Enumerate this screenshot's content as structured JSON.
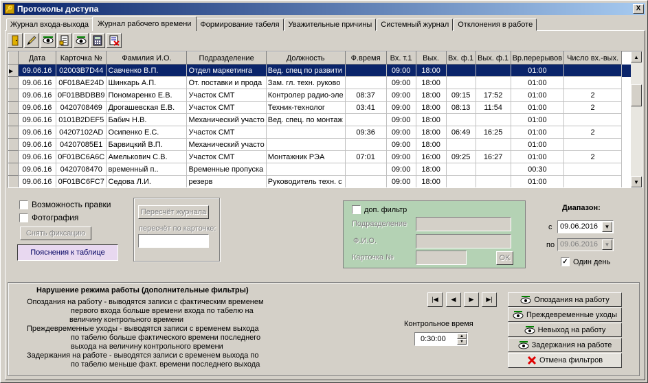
{
  "window": {
    "title": "Протоколы доступа",
    "close_glyph": "X"
  },
  "tabs": [
    {
      "label": "Журнал входа-выхода"
    },
    {
      "label": "Журнал рабочего времени",
      "active": true
    },
    {
      "label": "Формирование табеля"
    },
    {
      "label": "Уважительные причины"
    },
    {
      "label": "Системный журнал"
    },
    {
      "label": "Отклонения в работе"
    }
  ],
  "toolbar": {
    "icons": [
      "door-icon",
      "pen-icon",
      "eye-icon",
      "document-icon",
      "eye-icon",
      "calculator-icon",
      "delete-doc-icon"
    ]
  },
  "grid": {
    "columns": [
      "Дата",
      "Карточка №",
      "Фамилия И.О.",
      "Подразделение",
      "Должность",
      "Ф.время",
      "Вх. т.1",
      "Вых.",
      "Вх. ф.1",
      "Вых. ф.1",
      "Вр.перерывов",
      "Число вх.-вых."
    ],
    "rows": [
      [
        "09.06.16",
        "02003B7D44",
        "Савченко В.П.",
        "Отдел маркетинга",
        "Вед. спец по развити",
        "",
        "09:00",
        "18:00",
        "",
        "",
        "01:00",
        ""
      ],
      [
        "09.06.16",
        "0F018AE24D",
        "Шинкарь А.П.",
        "От. поставки и прода",
        "Зам. гл. техн. руково",
        "",
        "09:00",
        "18:00",
        "",
        "",
        "01:00",
        ""
      ],
      [
        "09.06.16",
        "0F01BBDBB9",
        "Пономаренко Е.В.",
        "Участок СМТ",
        "Контролер радио-эле",
        "08:37",
        "09:00",
        "18:00",
        "09:15",
        "17:52",
        "01:00",
        "2"
      ],
      [
        "09.06.16",
        "0420708469",
        "Дрогашевская Е.В.",
        "Участок СМТ",
        "Техник-технолог",
        "03:41",
        "09:00",
        "18:00",
        "08:13",
        "11:54",
        "01:00",
        "2"
      ],
      [
        "09.06.16",
        "0101B2DEF5",
        "Бабич Н.В.",
        "Механический участо",
        "Вед. спец. по монтаж",
        "",
        "09:00",
        "18:00",
        "",
        "",
        "01:00",
        ""
      ],
      [
        "09.06.16",
        "04207102AD",
        "Осипенко Е.С.",
        "Участок СМТ",
        "",
        "09:36",
        "09:00",
        "18:00",
        "06:49",
        "16:25",
        "01:00",
        "2"
      ],
      [
        "09.06.16",
        "04207085E1",
        "Барвицкий В.П.",
        "Механический участо",
        "",
        "",
        "09:00",
        "18:00",
        "",
        "",
        "01:00",
        ""
      ],
      [
        "09.06.16",
        "0F01BC6A6C",
        "Амелькович С.В.",
        "Участок СМТ",
        "Монтажник РЭА",
        "07:01",
        "09:00",
        "16:00",
        "09:25",
        "16:27",
        "01:00",
        "2"
      ],
      [
        "09.06.16",
        "0420708470",
        "временный п..",
        "Временные пропуска",
        "",
        "",
        "09:00",
        "18:00",
        "",
        "",
        "00:30",
        ""
      ],
      [
        "09.06.16",
        "0F01BC6FC7",
        "Седова Л.И.",
        "резерв",
        "Руководитель техн. с",
        "",
        "09:00",
        "18:00",
        "",
        "",
        "01:00",
        ""
      ]
    ]
  },
  "options": {
    "edit_label": "Возможность правки",
    "photo_label": "Фотография",
    "unfix_button": "Снять фиксацию",
    "explain_button": "Пояснения к таблице",
    "recalc_button": "Пересчёт журнала",
    "recalc_card_label": "пересчёт по карточке:"
  },
  "filter": {
    "extra_filter_label": "доп. фильтр",
    "dept_label": "Подразделение",
    "fio_label": "Ф.И.О.",
    "card_label": "Карточка №",
    "ok_button": "OK"
  },
  "range": {
    "title": "Диапазон:",
    "from_label": "с",
    "from_value": "09.06.2016",
    "to_label": "по",
    "to_value": "09.06.2016",
    "one_day_label": "Один день",
    "one_day_checked": true
  },
  "violations": {
    "title": "Нарушение режима работы  (дополнительные фильтры)",
    "lines": [
      "Опоздания на работу - выводятся записи с фактическим временем",
      "первого  входа  больше времени входа  по табелю на",
      "величину   контрольного времени",
      "Преждевременные уходы  -   выводятся записи с временем выхода",
      "по табелю  больше фактического времени  последнего",
      "выхода на величину  контрольного  времени",
      "Задержания на работе -  выводятся записи с временем выхода  по",
      "по табелю  меньше факт. времени  последнего  выхода"
    ],
    "control_time_label": "Контрольное время",
    "control_time_value": "0:30:00",
    "buttons": [
      "Опоздания на работу",
      "Преждевременные уходы",
      "Невыход на работу",
      "Задержания на работе"
    ],
    "cancel_button": "Отмена фильтров"
  },
  "colors": {
    "selection": "#0a246a",
    "title_start": "#0a246a",
    "green_panel": "#b4d2b4",
    "explain_bg": "#e8d8f0",
    "cancel_icon": "#e00000"
  }
}
